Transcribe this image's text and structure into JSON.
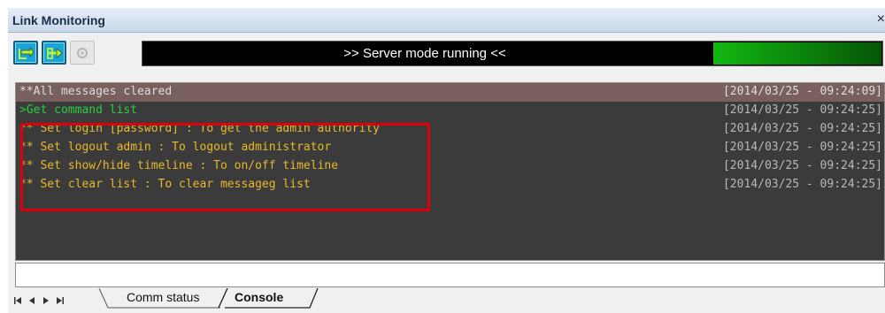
{
  "window": {
    "title": "Link Monitoring",
    "close_glyph": "×"
  },
  "toolbar": {
    "buttons": [
      {
        "name": "connect-toggle-button",
        "icon": "link-loop-icon",
        "state": "active"
      },
      {
        "name": "server-mode-button",
        "icon": "server-link-icon",
        "state": "active"
      },
      {
        "name": "settings-button",
        "icon": "gear-icon",
        "state": "disabled"
      }
    ],
    "status_text": ">> Server mode running <<",
    "status_color": "#11b811"
  },
  "log": {
    "colors": {
      "header_bg": "#7a5f5f",
      "command": "#2ecc40",
      "info": "#e8b92c",
      "header_text": "#dddddd",
      "timestamp": "#b8b8b8"
    },
    "rows": [
      {
        "type": "header",
        "message": "**All messages cleared",
        "timestamp": "[2014/03/25 - 09:24:09]"
      },
      {
        "type": "command",
        "message": ">Get command list",
        "timestamp": "[2014/03/25 - 09:24:25]"
      },
      {
        "type": "info",
        "message": "** Set login [password] : To get the admin authority",
        "timestamp": "[2014/03/25 - 09:24:25]"
      },
      {
        "type": "info",
        "message": "** Set logout admin : To logout administrator",
        "timestamp": "[2014/03/25 - 09:24:25]"
      },
      {
        "type": "info",
        "message": "** Set show/hide timeline : To on/off timeline",
        "timestamp": "[2014/03/25 - 09:24:25]"
      },
      {
        "type": "info",
        "message": "** Set clear list : To clear messageg list",
        "timestamp": "[2014/03/25 - 09:24:25]"
      }
    ]
  },
  "command_input": {
    "value": "",
    "placeholder": ""
  },
  "tabs": {
    "nav": [
      "first-page-icon",
      "previous-page-icon",
      "next-page-icon",
      "last-page-icon"
    ],
    "items": [
      {
        "label": "Comm status",
        "active": false
      },
      {
        "label": "Console",
        "active": true
      }
    ]
  }
}
